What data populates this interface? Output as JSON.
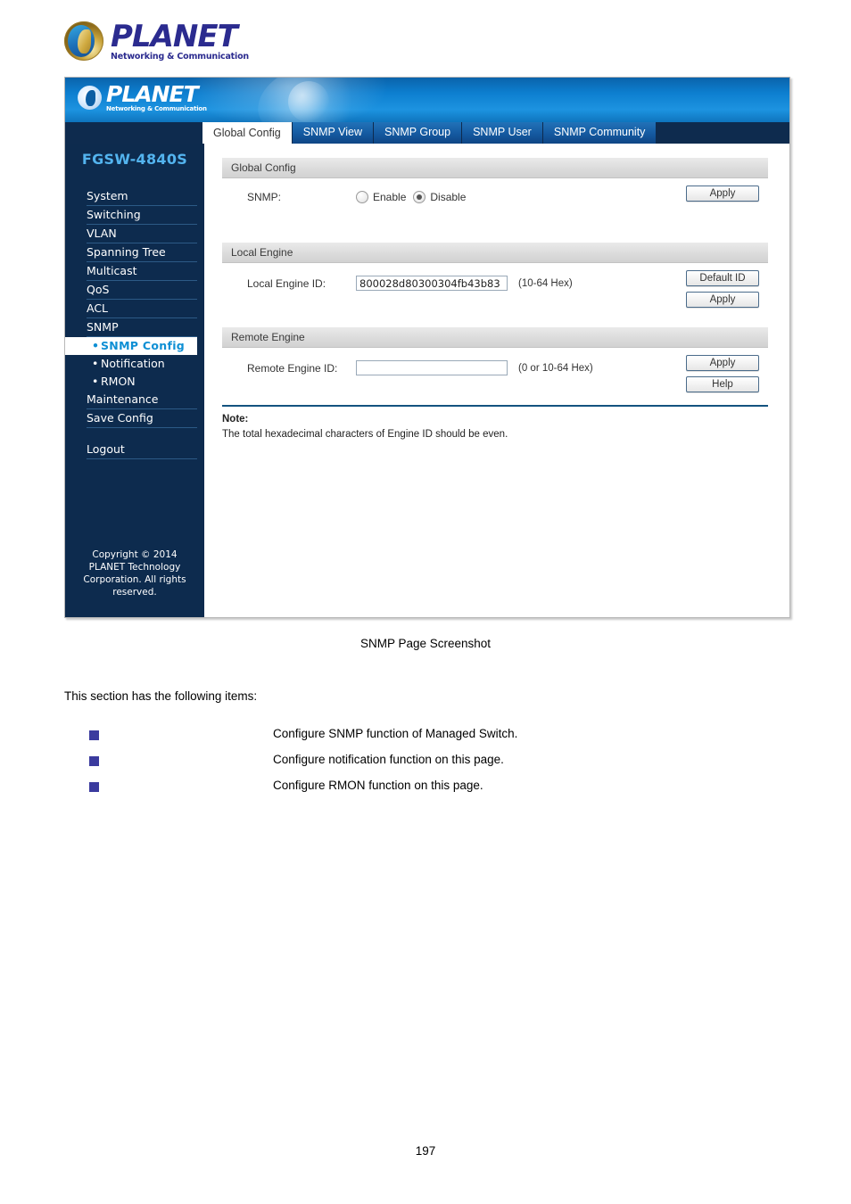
{
  "document": {
    "logo": {
      "word": "PLANET",
      "tagline": "Networking & Communication",
      "globe_icon": "planet-globe-icon"
    },
    "caption": "SNMP Page Screenshot",
    "intro": "This section has the following items:",
    "items": [
      {
        "bullet": "square-bullet-icon",
        "description": "Configure SNMP function of Managed Switch."
      },
      {
        "bullet": "square-bullet-icon",
        "description": "Configure notification function on this page."
      },
      {
        "bullet": "square-bullet-icon",
        "description": "Configure RMON function on this page."
      }
    ],
    "page_number": "197",
    "bullet_color": "#3b3b9e"
  },
  "device_ui": {
    "banner": {
      "logo_word": "PLANET",
      "logo_tagline": "Networking & Communication",
      "globe_icon": "planet-globe-icon",
      "gradient_from": "#0a63ab",
      "gradient_to": "#1d93e0"
    },
    "tabs": [
      {
        "label": "Global Config",
        "active": true
      },
      {
        "label": "SNMP View",
        "active": false
      },
      {
        "label": "SNMP Group",
        "active": false
      },
      {
        "label": "SNMP User",
        "active": false
      },
      {
        "label": "SNMP Community",
        "active": false
      }
    ],
    "sidebar": {
      "model": "FGSW-4840S",
      "background": "#0d2b4e",
      "active_text_color": "#0e8fd4",
      "items": [
        {
          "label": "System",
          "type": "top",
          "active": false
        },
        {
          "label": "Switching",
          "type": "top",
          "active": false
        },
        {
          "label": "VLAN",
          "type": "top",
          "active": false
        },
        {
          "label": "Spanning Tree",
          "type": "top",
          "active": false
        },
        {
          "label": "Multicast",
          "type": "top",
          "active": false
        },
        {
          "label": "QoS",
          "type": "top",
          "active": false
        },
        {
          "label": "ACL",
          "type": "top",
          "active": false
        },
        {
          "label": "SNMP",
          "type": "top",
          "active": false
        },
        {
          "label": "SNMP Config",
          "type": "sub",
          "active": true
        },
        {
          "label": "Notification",
          "type": "sub",
          "active": false
        },
        {
          "label": "RMON",
          "type": "sub",
          "active": false
        },
        {
          "label": "Maintenance",
          "type": "top",
          "active": false
        },
        {
          "label": "Save Config",
          "type": "top",
          "active": false
        },
        {
          "label": "Logout",
          "type": "top",
          "active": false
        }
      ],
      "copyright_line1": "Copyright © 2014",
      "copyright_line2": "PLANET Technology",
      "copyright_line3": "Corporation. All rights",
      "copyright_line4": "reserved."
    },
    "sections": {
      "global_config": {
        "title": "Global Config",
        "snmp_label": "SNMP:",
        "enable_label": "Enable",
        "disable_label": "Disable",
        "selected": "Disable",
        "apply_label": "Apply"
      },
      "local_engine": {
        "title": "Local Engine",
        "field_label": "Local Engine ID:",
        "field_value": "800028d80300304fb43b83",
        "field_placeholder": "",
        "hint": "(10-64 Hex)",
        "default_id_label": "Default ID",
        "apply_label": "Apply"
      },
      "remote_engine": {
        "title": "Remote Engine",
        "field_label": "Remote Engine ID:",
        "field_value": "",
        "field_placeholder": "",
        "hint": "(0 or 10-64 Hex)",
        "apply_label": "Apply",
        "help_label": "Help"
      }
    },
    "note": {
      "title": "Note:",
      "text": "The total hexadecimal characters of Engine ID should be even."
    }
  }
}
